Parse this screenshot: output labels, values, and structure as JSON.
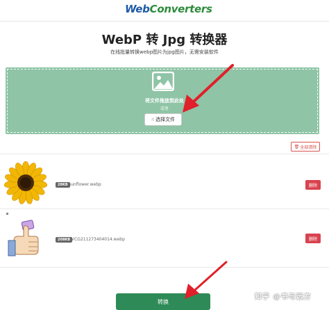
{
  "header": {
    "logo_part1": "Web",
    "logo_part2": "Converters"
  },
  "main": {
    "title": "WebP 转 Jpg 转换器",
    "subtitle": "在线批量转换webp图片为jpg图片，无需安装软件"
  },
  "dropzone": {
    "text": "将文件拖放到此处",
    "or_text": "或者",
    "choose_label": "选择文件",
    "icon": "image-icon",
    "icon_color": "#ffffff"
  },
  "toolbar": {
    "clear_all_label": "全部清除",
    "clear_icon": "trash-icon"
  },
  "files": [
    {
      "size": "28KB",
      "name": "sunflower.webp",
      "remove_label": "删除"
    },
    {
      "size": "208KB",
      "name": "VCG211273404014.webp",
      "remove_label": "删除"
    }
  ],
  "convert": {
    "label": "转换"
  },
  "watermark": {
    "text": "知乎 @书与远方"
  },
  "colors": {
    "accent_green": "#2e8b57",
    "drop_bg": "#8fc4a6",
    "danger": "#d9434f",
    "annotation_arrow": "#e0202a"
  }
}
